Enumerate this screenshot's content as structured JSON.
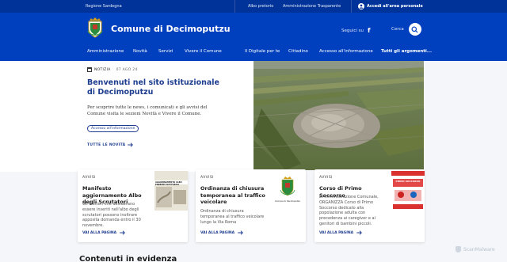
{
  "top_bar": {
    "region": "Regione Sardegna",
    "albo": "Albo pretorio",
    "trasparenza": "Amministrazione Trasparente",
    "login": "Accedi all'area personale"
  },
  "header": {
    "brand": "Comune di Decimoputzu",
    "social_label": "Seguici su",
    "search_label": "Cerca"
  },
  "nav": {
    "left": [
      "Amministrazione",
      "Novità",
      "Servizi",
      "Vivere il Comune"
    ],
    "right": [
      "Il Digitale per te",
      "Cittadino",
      "Accesso all'informazione"
    ],
    "all": "Tutti gli argomenti..."
  },
  "hero": {
    "tag": "NOTIZIA",
    "date": "07 AGO 24",
    "title": "Benvenuti nel sito istituzionale di Decimoputzu",
    "text": "Per scoprire tutte le news, i comunicati e gli avvisi del Comune visita le sezioni Novità e Vivere il Comune.",
    "chip": "Accesso all'informazione",
    "all_news": "TUTTE LE NOVITÀ"
  },
  "cards": [
    {
      "category": "AVVISI",
      "title": "Manifesto aggiornamento Albo degli Scrutatori",
      "description": "Gli elettori che desiderano essere inseriti nell'albo degli scrutatori possono inoltrare apposita domanda entro il 30 novembre.",
      "link": "VAI ALLA PAGINA",
      "thumb_text": "AGGIORNAMENTO ALBO ENDENTI ELETTORALI SCRUTATORI"
    },
    {
      "category": "AVVISI",
      "title": "Ordinanza di chiusura temporanea al traffico veicolare",
      "description": "Ordinanza di chiusura temporanea al traffico veicolare lungo la Via Roma",
      "link": "VAI ALLA PAGINA",
      "thumb_text": "Comune di Decimoputzu"
    },
    {
      "category": "AVVISI",
      "title": "Corso di Primo Soccorso",
      "description": "L'Amministrazione Comunale, ORGANIZZA Corso di Primo Soccorso dedicato alla popolazione adulta con precedenza ai caregiver e ai genitori di bambini piccoli.",
      "link": "VAI ALLA PAGINA",
      "thumb_text": "PRIMO SOCCORSO"
    }
  ],
  "bottom_heading": "Contenuti in evidenza",
  "watermark": "ScanMalware",
  "colors": {
    "primary": "#0040bf",
    "slim_bar": "#00339a",
    "link": "#1e3d8f"
  }
}
